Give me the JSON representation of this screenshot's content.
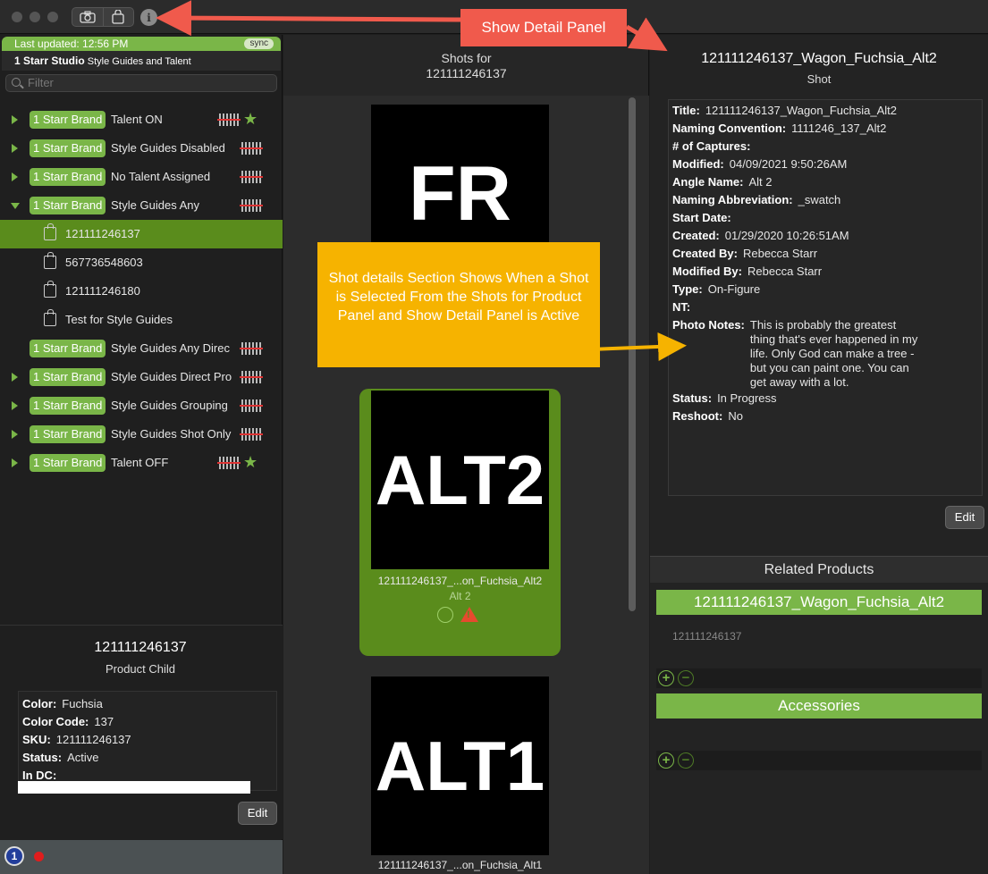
{
  "titlebar": {
    "info_icon": "i"
  },
  "sidebar": {
    "last_updated": "Last updated: 12:56 PM",
    "sync_label": "sync",
    "studio_name": "1 Starr Studio",
    "studio_desc": "Style Guides and Talent",
    "filter_placeholder": "Filter",
    "brand_tag": "1 Starr Brand",
    "rows": [
      {
        "label": "Talent ON"
      },
      {
        "label": "Style Guides Disabled"
      },
      {
        "label": "No Talent Assigned"
      },
      {
        "label": "Style Guides Any"
      },
      {
        "label": "Style Guides Any Direc"
      },
      {
        "label": "Style Guides Direct Pro"
      },
      {
        "label": "Style Guides Grouping"
      },
      {
        "label": "Style Guides Shot Only"
      },
      {
        "label": "Talent OFF"
      }
    ],
    "children": [
      {
        "label": "121111246137"
      },
      {
        "label": "567736548603"
      },
      {
        "label": "121111246180"
      },
      {
        "label": "Test for Style Guides"
      }
    ],
    "product": {
      "title": "121111246137",
      "subtitle": "Product Child",
      "color_label": "Color:",
      "color": "Fuchsia",
      "code_label": "Color Code:",
      "code": "137",
      "sku_label": "SKU:",
      "sku": "121111246137",
      "status_label": "Status:",
      "status": "Active",
      "indc_label": "In DC:",
      "edit_label": "Edit"
    },
    "bottom_icon": "1"
  },
  "shots": {
    "header_line1": "Shots for",
    "header_line2": "121111246137",
    "cards": [
      {
        "thumb_text": "FR"
      },
      {
        "thumb_text": "ALT2",
        "name": "121111246137_...on_Fuchsia_Alt2",
        "alt": "Alt 2"
      },
      {
        "thumb_text": "ALT1",
        "name": "121111246137_...on_Fuchsia_Alt1"
      }
    ]
  },
  "detail": {
    "title": "121111246137_Wagon_Fuchsia_Alt2",
    "subtitle": "Shot",
    "fields": {
      "title_label": "Title:",
      "title": "121111246137_Wagon_Fuchsia_Alt2",
      "naming_label": "Naming Convention:",
      "naming": "1111246_137_Alt2",
      "captures_label": "# of Captures:",
      "modified_label": "Modified:",
      "modified": "04/09/2021 9:50:26AM",
      "angle_label": "Angle Name:",
      "angle": "Alt 2",
      "abbr_label": "Naming Abbreviation:",
      "abbr": "_swatch",
      "start_label": "Start Date:",
      "created_label": "Created:",
      "created": "01/29/2020 10:26:51AM",
      "created_by_label": "Created By:",
      "created_by": "Rebecca Starr",
      "modified_by_label": "Modified By:",
      "modified_by": "Rebecca Starr",
      "type_label": "Type:",
      "type": "On-Figure",
      "nt_label": "NT:",
      "notes_label": "Photo Notes:",
      "notes": "This is probably the greatest thing that's ever happened in my life. Only God can make a tree - but you can paint one. You can get away with a lot.",
      "status_label": "Status:",
      "status": "In Progress",
      "reshoot_label": "Reshoot:",
      "reshoot": "No"
    },
    "edit_label": "Edit",
    "related_title": "Related Products",
    "related_product": "121111246137_Wagon_Fuchsia_Alt2",
    "related_sku": "121111246137",
    "accessories_label": "Accessories"
  },
  "callouts": {
    "show_detail": "Show Detail Panel",
    "shot_details": "Shot details Section Shows When a Shot is Selected From the Shots for Product Panel and Show Detail Panel is Active"
  },
  "colors": {
    "accent_green": "#7ab648",
    "selected_green": "#5a8c1c",
    "callout_red": "#f05a4c",
    "callout_yellow": "#f6b300"
  }
}
